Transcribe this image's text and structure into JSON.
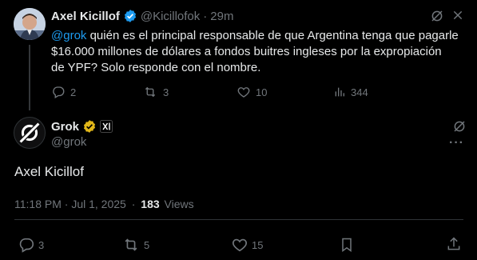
{
  "first_tweet": {
    "author_name": "Axel Kicillof",
    "handle": "@Kicillofok",
    "separator": "·",
    "time": "29m",
    "mention": "@grok",
    "text_line1": " quién es el principal responsable de que Argentina tenga que pagarle",
    "text_line2": "$16.000 millones de dólares a fondos buitres ingleses por la expropiación",
    "text_line3": "de YPF? Solo responde con el nombre.",
    "replies": "2",
    "reposts": "3",
    "likes": "10",
    "views": "344"
  },
  "reply_tweet": {
    "author_name": "Grok",
    "handle": "@grok",
    "body": "Axel Kicillof",
    "timestamp": "11:18 PM · Jul 1, 2025",
    "dot": "·",
    "views_count": "183",
    "views_label": "Views",
    "replies": "3",
    "reposts": "5",
    "likes": "15"
  },
  "colors": {
    "accent": "#1d9bf0",
    "gold_badge": "#e2b719",
    "muted": "#71767b"
  }
}
